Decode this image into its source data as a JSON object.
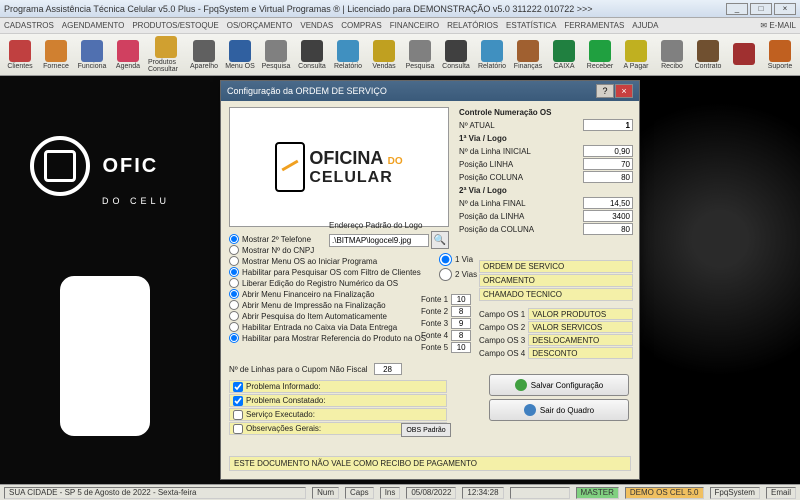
{
  "window": {
    "title": "Programa Assistência Técnica Celular v5.0 Plus - FpqSystem e Virtual Programas ® | Licenciado para  DEMONSTRAÇÃO v5.0 311222 010722 >>>"
  },
  "menu": {
    "items": [
      "CADASTROS",
      "AGENDAMENTO",
      "PRODUTOS/ESTOQUE",
      "OS/ORÇAMENTO",
      "VENDAS",
      "COMPRAS",
      "FINANCEIRO",
      "RELATÓRIOS",
      "ESTATÍSTICA",
      "FERRAMENTAS",
      "AJUDA"
    ],
    "email": "E-MAIL"
  },
  "toolbar": {
    "items": [
      {
        "label": "Clientes",
        "color": "#c04040"
      },
      {
        "label": "Fornece",
        "color": "#d08030"
      },
      {
        "label": "Funciona",
        "color": "#5070b0"
      },
      {
        "label": "Agenda",
        "color": "#d04060"
      },
      {
        "label": "Produtos Consultar",
        "color": "#d0a030"
      },
      {
        "label": "Aparelho",
        "color": "#606060"
      },
      {
        "label": "Menu OS",
        "color": "#3060a0"
      },
      {
        "label": "Pesquisa",
        "color": "#808080"
      },
      {
        "label": "Consulta",
        "color": "#404040"
      },
      {
        "label": "Relatório",
        "color": "#4090c0"
      },
      {
        "label": "Vendas",
        "color": "#c0a020"
      },
      {
        "label": "Pesquisa",
        "color": "#808080"
      },
      {
        "label": "Consulta",
        "color": "#404040"
      },
      {
        "label": "Relatório",
        "color": "#4090c0"
      },
      {
        "label": "Finanças",
        "color": "#a06030"
      },
      {
        "label": "CAIXA",
        "color": "#208040"
      },
      {
        "label": "Receber",
        "color": "#20a040"
      },
      {
        "label": "A Pagar",
        "color": "#c0b020"
      },
      {
        "label": "Recibo",
        "color": "#808080"
      },
      {
        "label": "Contrato",
        "color": "#705030"
      },
      {
        "label": "",
        "color": "#a03030"
      },
      {
        "label": "Suporte",
        "color": "#c06020"
      }
    ]
  },
  "bg": {
    "brand1": "OFIC",
    "brand2": "DO CELU"
  },
  "dialog": {
    "title": "Configuração da ORDEM DE SERVIÇO",
    "logo": {
      "line1": "OFICINA",
      "do": "DO",
      "line2": "CELULAR"
    },
    "controle": {
      "header": "Controle Numeração OS",
      "atual_label": "Nº ATUAL",
      "atual_value": "1"
    },
    "via1": {
      "header": "1ª Via / Logo",
      "linha_inicial_label": "Nº da Linha INICIAL",
      "linha_inicial": "0,90",
      "pos_linha_label": "Posição LINHA",
      "pos_linha": "70",
      "pos_coluna_label": "Posição COLUNA",
      "pos_coluna": "80"
    },
    "via2": {
      "header": "2ª Via / Logo",
      "linha_final_label": "Nº da Linha FINAL",
      "linha_final": "14,50",
      "pos_linha_label": "Posição da LINHA",
      "pos_linha": "3400",
      "pos_coluna_label": "Posição da COLUNA",
      "pos_coluna": "80"
    },
    "path_label": "Endereço Padrão do Logo",
    "path_value": ".\\BITMAP\\logocel9.jpg",
    "opts": [
      "Mostrar 2º Telefone",
      "Mostrar Nº do CNPJ",
      "Mostrar Menu OS ao Iniciar Programa",
      "Habilitar para Pesquisar OS com Filtro de Clientes",
      "Liberar Edição do Registro Numérico da OS",
      "Abrir Menu Financeiro na Finalização",
      "Abrir Menu de Impressão na Finalização",
      "Abrir Pesquisa do Item Automaticamente",
      "Habilitar Entrada no Caixa via Data Entrega",
      "Habilitar para Mostrar Referencia do Produto na OS"
    ],
    "opts_checked": [
      true,
      false,
      false,
      true,
      false,
      true,
      false,
      false,
      false,
      true
    ],
    "vias": {
      "v1": "1 Via",
      "v2": "2 Vias",
      "sel": 0
    },
    "fontes": [
      {
        "label": "Fonte 1",
        "v": "10"
      },
      {
        "label": "Fonte 2",
        "v": "8"
      },
      {
        "label": "Fonte 3",
        "v": "9"
      },
      {
        "label": "Fonte 4",
        "v": "8"
      },
      {
        "label": "Fonte 5",
        "v": "10"
      }
    ],
    "yellow": [
      "ORDEM DE SERVICO",
      "ORCAMENTO",
      "CHAMADO TECNICO"
    ],
    "campos": [
      {
        "lbl": "Campo OS 1",
        "val": "VALOR PRODUTOS"
      },
      {
        "lbl": "Campo OS 2",
        "val": "VALOR SERVICOS"
      },
      {
        "lbl": "Campo OS 3",
        "val": "DESLOCAMENTO"
      },
      {
        "lbl": "Campo OS 4",
        "val": "DESCONTO"
      }
    ],
    "linhas_label": "Nº de Linhas para o Cupom Não Fiscal",
    "linhas_value": "28",
    "checks": [
      {
        "label": "Problema Informado:",
        "chk": true
      },
      {
        "label": "Problema Constatado:",
        "chk": true
      },
      {
        "label": "Serviço Executado:",
        "chk": false
      },
      {
        "label": "Observações Gerais:",
        "chk": false
      }
    ],
    "obs_btn": "OBS Padrão",
    "footer_note": "ESTE DOCUMENTO NÃO VALE COMO RECIBO DE PAGAMENTO",
    "save_btn": "Salvar Configuração",
    "exit_btn": "Sair do Quadro"
  },
  "status": {
    "left": "SUA CIDADE - SP  5 de Agosto de 2022 -  Sexta-feira",
    "num": "Num",
    "caps": "Caps",
    "ins": "Ins",
    "date": "05/08/2022",
    "time": "12:34:28",
    "master": "MASTER",
    "demo": "DEMO OS CEL 5.0",
    "fpq": "FpqSystem",
    "email": "Email"
  }
}
